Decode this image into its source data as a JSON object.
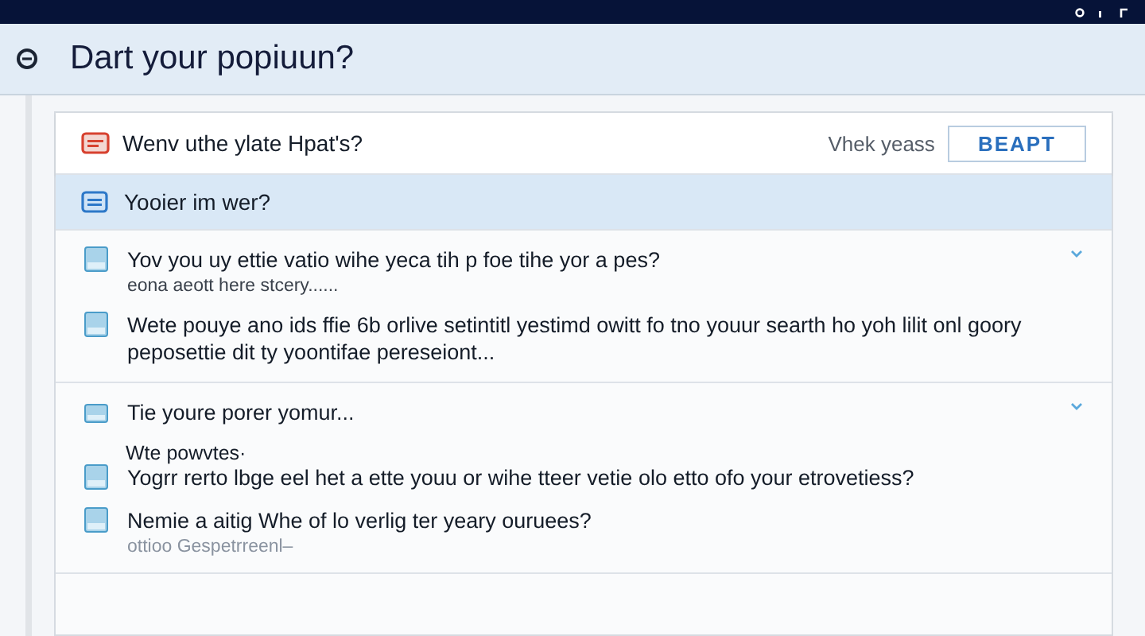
{
  "title": "Dart your popiuun?",
  "toolbar": {
    "question": "Wenv uthe ylate Hpat's?",
    "hint": "Vhek yeass",
    "button": "BEAPT"
  },
  "rows": [
    {
      "label": "Yooier im wer?",
      "selected": true
    }
  ],
  "groups": [
    {
      "items": [
        {
          "title": "Yov you uy ettie vatio wihe yeca tih p foe tihe yor a pes?",
          "subtitle": "eona aeott here stcery......",
          "selected": false
        },
        {
          "title": "Wete pouye ano ids ffie 6b orlive setintitl yestimd owitt fo tno youur searth ho yoh lilit onl goory peposettie dit ty yoontifae pereseiont...",
          "selected": false
        }
      ]
    },
    {
      "heading": "Tie youre porer yomur...",
      "items": [
        {
          "label": "Wte powvtes·",
          "title": "Yogrr rerto lbge eel het a ette youu or wihe tteer vetie olo etto ofo your etrovetiess?",
          "selected": false
        },
        {
          "title": "Nemie a aitig Whe of lo verlig ter yeary ouruees?",
          "subtitle": "ottioo Gespetrreenl–",
          "selected": false
        }
      ]
    }
  ]
}
